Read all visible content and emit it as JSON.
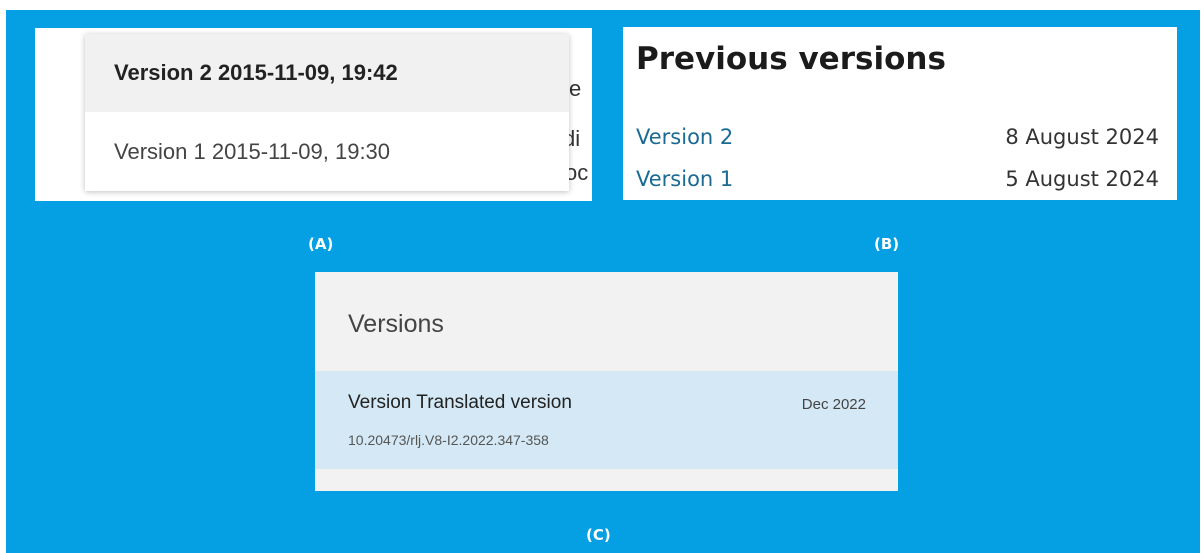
{
  "panel_a": {
    "menu_items": [
      {
        "label": "Version 2 2015-11-09, 19:42",
        "selected": true
      },
      {
        "label": "Version 1 2015-11-09, 19:30",
        "selected": false
      }
    ],
    "background_fragments": [
      "e",
      "di",
      "oc"
    ]
  },
  "panel_b": {
    "title": "Previous versions",
    "versions": [
      {
        "label": "Version 2",
        "date": "8 August 2024"
      },
      {
        "label": "Version 1",
        "date": "5 August 2024"
      }
    ],
    "link_color": "#1a6a93"
  },
  "panel_c": {
    "heading": "Versions",
    "versions": [
      {
        "name": "Version Translated version",
        "date": "Dec 2022",
        "doi": "10.20473/rlj.V8-I2.2022.347-358"
      }
    ],
    "highlight_color": "#d4e9f5"
  },
  "labels": {
    "a": "(A)",
    "b": "(B)",
    "c": "(C)"
  },
  "colors": {
    "background": "#05a0e3"
  }
}
